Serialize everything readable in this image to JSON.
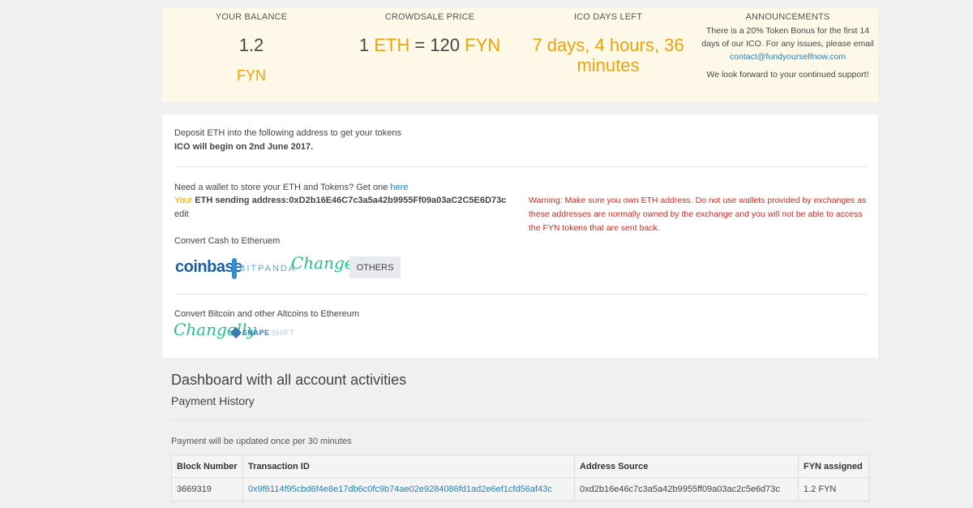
{
  "stats": {
    "balance": {
      "label": "YOUR BALANCE",
      "value": "1.2",
      "unit": "FYN"
    },
    "price": {
      "label": "CROWDSALE PRICE",
      "lhs_num": "1",
      "lhs_unit": "ETH",
      "eq": "=",
      "rhs_num": "120",
      "rhs_unit": "FYN"
    },
    "days": {
      "label": "ICO DAYS LEFT",
      "value": "7 days, 4 hours, 36 minutes"
    },
    "announcements": {
      "label": "ANNOUNCEMENTS",
      "text": "There is a 20% Token Bonus for the first 14 days of our ICO. For any issues, please email",
      "email": "contact@fundyourselfnow.com",
      "text2": "We look forward to your continued support!"
    }
  },
  "deposit": {
    "intro": "Deposit ETH into the following address to get your tokens",
    "begin": "ICO will begin on 2nd June 2017.",
    "wallet_q": "Need a wallet to store your ETH and Tokens? Get one",
    "wallet_link": "here",
    "your": "Your",
    "sending_label": "ETH sending address:",
    "address": "0xD2b16E46C7c3a5a42b9955Ff09a03aC2C5E6D73c",
    "edit": "edit",
    "warning": "Warning: Make sure you own ETH address. Do not use wallets provided by exchanges as these addresses are normally owned by the exchange and you will not be able to access the FYN tokens that are sent back.",
    "convert_cash": "Convert Cash to Etheruem",
    "cash_logos": {
      "coinbase": "coinbase",
      "bitpanda": "BITPANDA",
      "changelly": "Changelly"
    },
    "others": "OTHERS",
    "convert_alt": "Convert Bitcoin and other Altcoins to Ethereum",
    "alt_logos": {
      "changelly": "Changelly",
      "shapeshift_a": "SHAPE",
      "shapeshift_b": "SHIFT"
    }
  },
  "dashboard": {
    "title": "Dashboard with all account activities",
    "subtitle": "Payment History",
    "note": "Payment will be updated once per 30 minutes",
    "columns": [
      "Block Number",
      "Transaction ID",
      "Address Source",
      "FYN assigned"
    ],
    "rows": [
      [
        "3669319",
        "0x9f6114f95cbd6f4e8e17db6c0fc9b74ae02e9284086fd1ad2e6ef1cfd56af43c",
        "0xd2b16e46c7c3a5a42b9955ff09a03ac2c5e6d73c",
        "1.2 FYN"
      ]
    ]
  }
}
